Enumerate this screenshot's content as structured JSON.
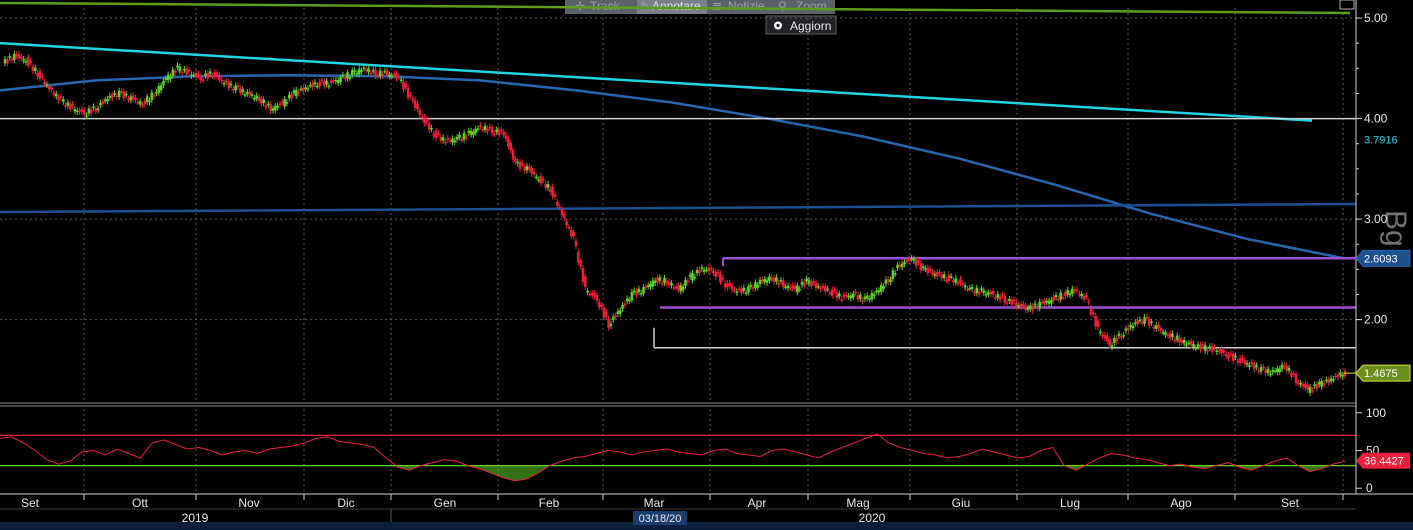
{
  "toolbar": {
    "items": [
      "Track",
      "Annotare",
      "Notizie",
      "Zoom"
    ],
    "refresh_label": "Aggiorn"
  },
  "watermark": "Bg",
  "colors": {
    "background": "#000000",
    "up_candle": "#5fcf2a",
    "down_candle": "#e8203c",
    "ma_short": "#22d3e0",
    "ma_long": "#2a66ad",
    "trend_flat": "#1e4f8f",
    "band_purple": "#9b4fd1",
    "level_line": "#cfcfcf",
    "top_green": "#5a9e1c",
    "rsi_line": "#e8203c",
    "rsi_upper": "#e8203c",
    "rsi_lower": "#5fcf2a",
    "last_price_tag": "#6b8e1f"
  },
  "chart_data": [
    {
      "type": "candlestick",
      "x_labels": [
        "Set",
        "Ott",
        "Nov",
        "Dic",
        "Gen",
        "Feb",
        "Mar",
        "Apr",
        "Mag",
        "Giu",
        "Lug",
        "Ago",
        "Set"
      ],
      "year_labels": [
        "2019",
        "2020"
      ],
      "cursor_date": "03/18/20",
      "y_ticks": [
        "5.00",
        "4.00",
        "3.00",
        "2.00"
      ],
      "ylim": [
        1.2,
        5.1
      ],
      "y_scale": "linear",
      "tags": [
        {
          "label": "3.7916",
          "value": 3.7916
        },
        {
          "label": "2.6093",
          "value": 2.6093
        },
        {
          "label": "1.4675",
          "value": 1.4675
        }
      ],
      "closes_approx": [
        4.55,
        4.62,
        4.58,
        4.45,
        4.3,
        4.18,
        4.1,
        4.05,
        4.1,
        4.2,
        4.25,
        4.2,
        4.15,
        4.25,
        4.4,
        4.5,
        4.45,
        4.4,
        4.45,
        4.35,
        4.3,
        4.25,
        4.2,
        4.1,
        4.15,
        4.25,
        4.3,
        4.35,
        4.35,
        4.4,
        4.45,
        4.5,
        4.45,
        4.45,
        4.4,
        4.2,
        4.0,
        3.85,
        3.78,
        3.8,
        3.85,
        3.92,
        3.88,
        3.85,
        3.55,
        3.5,
        3.4,
        3.3,
        3.05,
        2.8,
        2.3,
        2.2,
        1.95,
        2.1,
        2.25,
        2.3,
        2.4,
        2.38,
        2.3,
        2.42,
        2.5,
        2.48,
        2.35,
        2.28,
        2.3,
        2.38,
        2.42,
        2.35,
        2.3,
        2.38,
        2.32,
        2.28,
        2.22,
        2.25,
        2.2,
        2.28,
        2.4,
        2.55,
        2.6,
        2.5,
        2.45,
        2.42,
        2.38,
        2.3,
        2.28,
        2.25,
        2.2,
        2.15,
        2.1,
        2.15,
        2.2,
        2.25,
        2.3,
        2.2,
        1.9,
        1.75,
        1.85,
        1.95,
        2.0,
        1.92,
        1.85,
        1.8,
        1.75,
        1.72,
        1.7,
        1.65,
        1.6,
        1.55,
        1.5,
        1.48,
        1.55,
        1.4,
        1.3,
        1.35,
        1.4,
        1.47
      ],
      "overlays": [
        {
          "name": "top-green-trend",
          "from_value": 5.15,
          "to_value": 5.05
        },
        {
          "name": "ma-short",
          "from_value": 4.75,
          "to_value": 3.98
        },
        {
          "name": "ma-long",
          "values": [
            4.28,
            4.38,
            4.42,
            4.43,
            4.42,
            4.38,
            4.28,
            4.16,
            4.0,
            3.82,
            3.6,
            3.34,
            3.05,
            2.8,
            2.61
          ]
        },
        {
          "name": "flat-trend",
          "from_value": 3.07,
          "to_value": 3.15
        },
        {
          "name": "level-4",
          "value": 4.0
        },
        {
          "name": "band-upper",
          "value": 2.61
        },
        {
          "name": "band-lower",
          "value": 2.12
        },
        {
          "name": "support-line",
          "value": 1.72
        }
      ]
    },
    {
      "type": "line",
      "name": "RSI",
      "y_ticks": [
        "100",
        "50",
        "0"
      ],
      "ylim": [
        -5,
        105
      ],
      "upper_level": 70,
      "lower_level": 30,
      "last_value": 36.4427,
      "last_label": "36.4427",
      "values": [
        66,
        68,
        60,
        50,
        38,
        32,
        36,
        48,
        50,
        44,
        52,
        46,
        40,
        60,
        64,
        58,
        52,
        54,
        50,
        44,
        48,
        50,
        46,
        52,
        54,
        56,
        60,
        66,
        68,
        62,
        60,
        58,
        54,
        40,
        28,
        24,
        30,
        34,
        38,
        36,
        30,
        26,
        20,
        14,
        10,
        12,
        20,
        30,
        36,
        40,
        42,
        46,
        50,
        48,
        44,
        48,
        50,
        52,
        48,
        46,
        44,
        50,
        52,
        46,
        44,
        42,
        50,
        52,
        48,
        44,
        40,
        48,
        54,
        60,
        66,
        72,
        60,
        54,
        50,
        46,
        44,
        40,
        42,
        46,
        52,
        48,
        44,
        40,
        42,
        50,
        54,
        30,
        24,
        32,
        40,
        46,
        44,
        40,
        38,
        34,
        30,
        32,
        28,
        26,
        30,
        34,
        28,
        24,
        30,
        36,
        40,
        30,
        22,
        26,
        32,
        36
      ]
    }
  ]
}
